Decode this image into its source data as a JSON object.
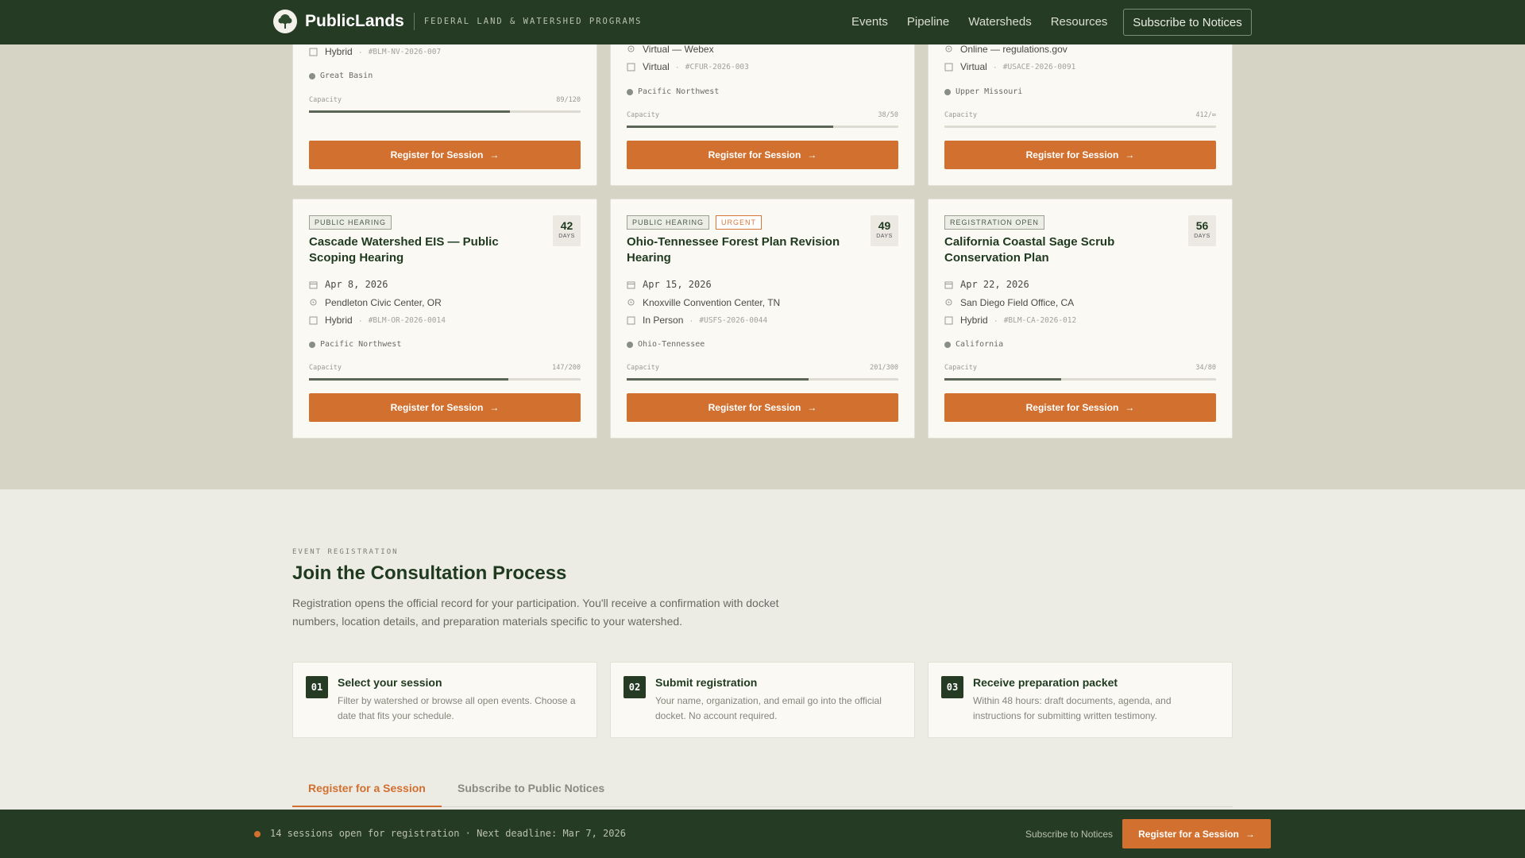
{
  "nav": {
    "brand": "PublicLands",
    "tagline": "FEDERAL LAND & WATERSHED PROGRAMS",
    "links": [
      "Events",
      "Pipeline",
      "Watersheds",
      "Resources"
    ],
    "subscribe": "Subscribe to Notices"
  },
  "top_cards": [
    {
      "mode": "Hybrid",
      "code": "#BLM-NV-2026-007",
      "region": "Great Basin",
      "capacity_label": "Capacity",
      "capacity": "89/120",
      "fill": 0.74,
      "button": "Register for Session"
    },
    {
      "location": "Virtual — Webex",
      "mode": "Virtual",
      "code": "#CFUR-2026-003",
      "region": "Pacific Northwest",
      "capacity_label": "Capacity",
      "capacity": "38/50",
      "fill": 0.76,
      "button": "Register for Session"
    },
    {
      "location": "Online — regulations.gov",
      "mode": "Virtual",
      "code": "#USACE-2026-0091",
      "region": "Upper Missouri",
      "capacity_label": "Capacity",
      "capacity": "412/∞",
      "fill": 0,
      "button": "Register for Session"
    }
  ],
  "cards": [
    {
      "badges": [
        "PUBLIC HEARING"
      ],
      "days": "42",
      "days_label": "DAYS",
      "title": "Cascade Watershed EIS — Public Scoping Hearing",
      "date": "Apr 8, 2026",
      "location": "Pendleton Civic Center, OR",
      "mode": "Hybrid",
      "code": "#BLM-OR-2026-0014",
      "region": "Pacific Northwest",
      "capacity_label": "Capacity",
      "capacity": "147/200",
      "fill": 0.735,
      "button": "Register for Session"
    },
    {
      "badges": [
        "PUBLIC HEARING",
        "URGENT"
      ],
      "days": "49",
      "days_label": "DAYS",
      "title": "Ohio-Tennessee Forest Plan Revision Hearing",
      "date": "Apr 15, 2026",
      "location": "Knoxville Convention Center, TN",
      "mode": "In Person",
      "code": "#USFS-2026-0044",
      "region": "Ohio-Tennessee",
      "capacity_label": "Capacity",
      "capacity": "201/300",
      "fill": 0.67,
      "button": "Register for Session"
    },
    {
      "badges": [
        "REGISTRATION OPEN"
      ],
      "days": "56",
      "days_label": "DAYS",
      "title": "California Coastal Sage Scrub Conservation Plan",
      "date": "Apr 22, 2026",
      "location": "San Diego Field Office, CA",
      "mode": "Hybrid",
      "code": "#BLM-CA-2026-012",
      "region": "California",
      "capacity_label": "Capacity",
      "capacity": "34/80",
      "fill": 0.43,
      "button": "Register for Session"
    }
  ],
  "join": {
    "kicker": "EVENT REGISTRATION",
    "title": "Join the Consultation Process",
    "desc": "Registration opens the official record for your participation. You'll receive a confirmation with docket numbers, location details, and preparation materials specific to your watershed."
  },
  "steps": [
    {
      "num": "01",
      "title": "Select your session",
      "desc": "Filter by watershed or browse all open events. Choose a date that fits your schedule."
    },
    {
      "num": "02",
      "title": "Submit registration",
      "desc": "Your name, organization, and email go into the official docket. No account required."
    },
    {
      "num": "03",
      "title": "Receive preparation packet",
      "desc": "Within 48 hours: draft documents, agenda, and instructions for submitting written testimony."
    }
  ],
  "tabs": [
    "Register for a Session",
    "Subscribe to Public Notices"
  ],
  "bottom": {
    "status": "14 sessions open for registration · Next deadline: Mar 7, 2026",
    "subscribe": "Subscribe to Notices",
    "register": "Register for a Session"
  },
  "colors": {
    "accent": "#d2702f",
    "brand": "#263b24"
  }
}
